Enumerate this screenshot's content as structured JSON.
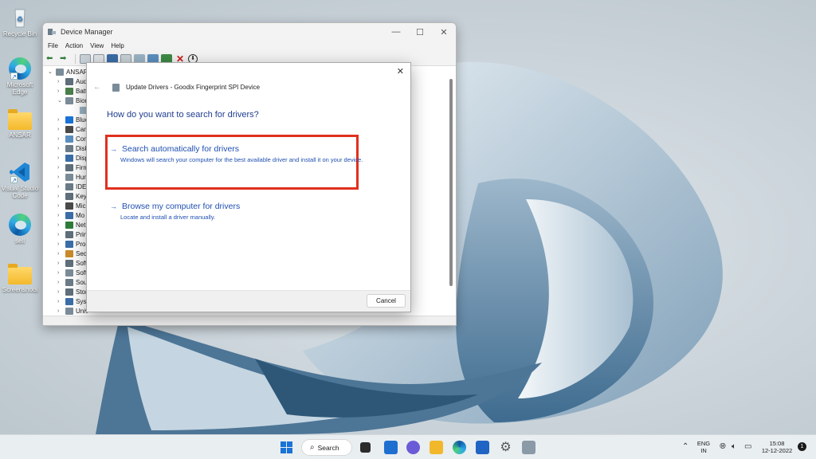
{
  "desktop": {
    "icons": [
      {
        "label": "Recycle Bin",
        "icon": "recycle-bin-icon"
      },
      {
        "label": "Microsoft Edge",
        "icon": "edge-icon"
      },
      {
        "label": "ANSAR",
        "icon": "folder-icon"
      },
      {
        "label": "Visual Studio Code",
        "icon": "vscode-icon"
      },
      {
        "label": "sell",
        "icon": "edge-icon"
      },
      {
        "label": "Screenshots",
        "icon": "folder-icon"
      }
    ]
  },
  "device_manager": {
    "title": "Device Manager",
    "menu": [
      "File",
      "Action",
      "View",
      "Help"
    ],
    "tree": [
      {
        "label": "ANSAR",
        "chev": "⌄"
      },
      {
        "label": "Aud",
        "chev": "›"
      },
      {
        "label": "Batt",
        "chev": "›"
      },
      {
        "label": "Biom",
        "chev": "⌄"
      },
      {
        "label": "",
        "chev": ""
      },
      {
        "label": "Blue",
        "chev": "›"
      },
      {
        "label": "Cam",
        "chev": "›"
      },
      {
        "label": "Com",
        "chev": "›"
      },
      {
        "label": "Disk",
        "chev": "›"
      },
      {
        "label": "Disp",
        "chev": "›"
      },
      {
        "label": "Firm",
        "chev": "›"
      },
      {
        "label": "Hum",
        "chev": "›"
      },
      {
        "label": "IDE",
        "chev": "›"
      },
      {
        "label": "Key",
        "chev": "›"
      },
      {
        "label": "Mic",
        "chev": "›"
      },
      {
        "label": "Mo",
        "chev": "›"
      },
      {
        "label": "Net",
        "chev": "›"
      },
      {
        "label": "Prin",
        "chev": "›"
      },
      {
        "label": "Proc",
        "chev": "›"
      },
      {
        "label": "Sec",
        "chev": "›"
      },
      {
        "label": "Soft",
        "chev": "›"
      },
      {
        "label": "Soft",
        "chev": "›"
      },
      {
        "label": "Sou",
        "chev": "›"
      },
      {
        "label": "Stor",
        "chev": "›"
      },
      {
        "label": "Syst",
        "chev": "›"
      },
      {
        "label": "Univ",
        "chev": "›"
      }
    ]
  },
  "dialog": {
    "title": "Update Drivers - Goodix Fingerprint SPI Device",
    "question": "How do you want to search for drivers?",
    "option_auto": {
      "title": "Search automatically for drivers",
      "desc": "Windows will search your computer for the best available driver and install it on your device."
    },
    "option_browse": {
      "title": "Browse my computer for drivers",
      "desc": "Locate and install a driver manually."
    },
    "cancel_label": "Cancel",
    "highlight_color": "#e0301e"
  },
  "taskbar": {
    "search_label": "Search",
    "lang_top": "ENG",
    "lang_bottom": "IN",
    "time": "15:08",
    "date": "12-12-2022",
    "notification_count": "1"
  }
}
